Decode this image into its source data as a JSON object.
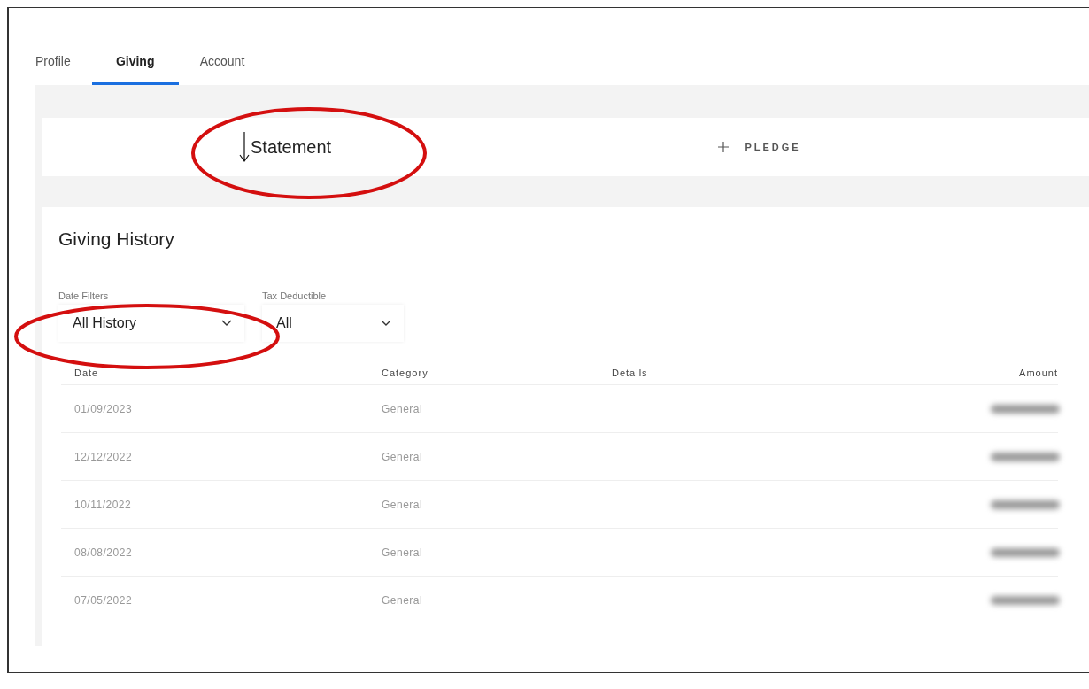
{
  "tabs": [
    {
      "label": "Profile",
      "selected": false
    },
    {
      "label": "Giving",
      "selected": true
    },
    {
      "label": "Account",
      "selected": false
    }
  ],
  "actions": [
    {
      "kind": "download",
      "label": "Statement"
    },
    {
      "kind": "add",
      "label": "PLEDGE"
    }
  ],
  "history": {
    "title": "Giving History",
    "filters": [
      {
        "label": "Date Filters",
        "value": "All History"
      },
      {
        "label": "Tax Deductible",
        "value": "All"
      }
    ],
    "columns": [
      "Date",
      "Category",
      "Details",
      "Amount"
    ],
    "rows": [
      {
        "date": "01/09/2023",
        "category": "General",
        "amount_redacted": true
      },
      {
        "date": "12/12/2022",
        "category": "General",
        "amount_redacted": true
      },
      {
        "date": "10/11/2022",
        "category": "General",
        "amount_redacted": true
      },
      {
        "date": "08/08/2022",
        "category": "General",
        "amount_redacted": true
      },
      {
        "date": "07/05/2022",
        "category": "General",
        "amount_redacted": true
      }
    ]
  },
  "annotations": [
    {
      "kind": "ellipse"
    },
    {
      "kind": "ellipse"
    }
  ]
}
